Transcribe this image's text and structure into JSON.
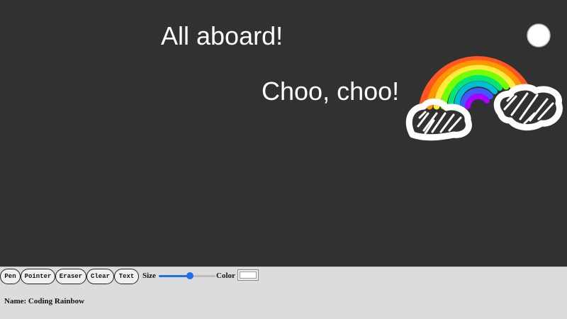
{
  "canvas": {
    "background": "#313131",
    "texts": [
      "All aboard!",
      "Choo, choo!"
    ],
    "drawing_colors": [
      "#ff5722",
      "#ff9800",
      "#ffeb3b",
      "#76ff03",
      "#00e676",
      "#00bcd4",
      "#3d5afe",
      "#aa00ff",
      "#ffffff"
    ],
    "drawing_icons": [
      "rainbow-drawing",
      "cloud-drawing",
      "sun-drawing"
    ]
  },
  "toolbar": {
    "tools": [
      "Pen",
      "Pointer",
      "Eraser",
      "Clear",
      "Text"
    ],
    "size_label": "Size",
    "size_value": 0.55,
    "color_label": "Color",
    "color_value": "#ffffff",
    "name_line": "Name: Coding Rainbow",
    "accent": "#1a73e8"
  }
}
